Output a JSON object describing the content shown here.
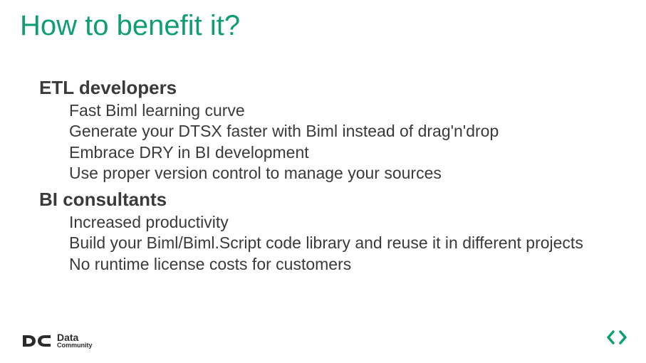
{
  "title": "How to benefit it?",
  "sections": [
    {
      "heading": "ETL developers",
      "items": [
        "Fast Biml learning curve",
        "Generate your DTSX faster with Biml instead of drag'n'drop",
        "Embrace DRY in BI development",
        "Use proper version control to manage your sources"
      ]
    },
    {
      "heading": "BI consultants",
      "items": [
        "Increased productivity",
        "Build your Biml/Biml.Script code library and reuse it in different projects",
        "No runtime license costs for customers"
      ]
    }
  ],
  "footer": {
    "logo_primary": "Data",
    "logo_secondary": "Community"
  }
}
